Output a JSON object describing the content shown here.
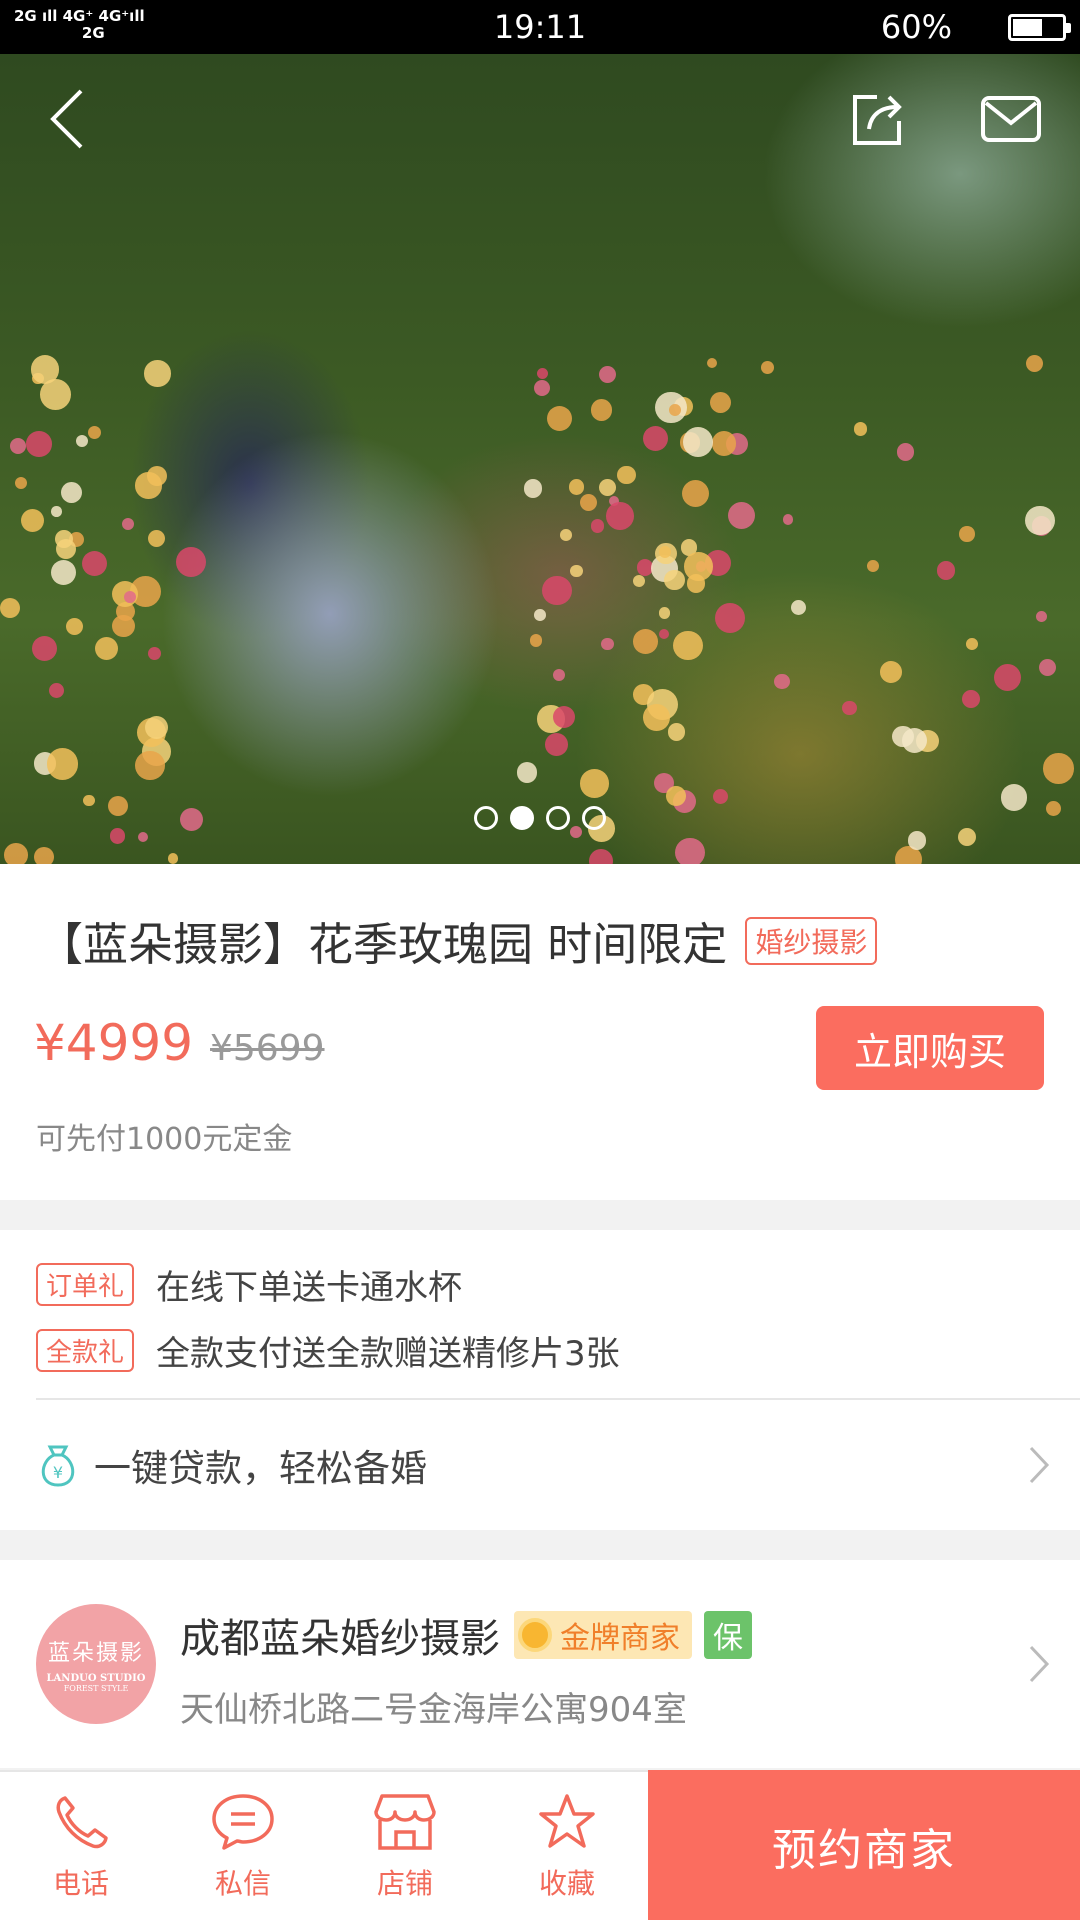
{
  "status_bar": {
    "signal_text": "2G 4G⁺ 4G⁺\n   2G",
    "time": "19:11",
    "battery_percent": "60%",
    "battery_level": 0.6
  },
  "hero": {
    "carousel_total": 4,
    "carousel_active_index": 1
  },
  "product": {
    "title": "【蓝朵摄影】花季玫瑰园 时间限定",
    "category_tag": "婚纱摄影",
    "price": "¥4999",
    "original_price": "¥5699",
    "buy_label": "立即购买",
    "deposit_note": "可先付1000元定金"
  },
  "gifts": [
    {
      "tag": "订单礼",
      "text": "在线下单送卡通水杯"
    },
    {
      "tag": "全款礼",
      "text": "全款支付送全款赠送精修片3张"
    }
  ],
  "loan": {
    "text": "一键贷款，轻松备婚"
  },
  "merchant": {
    "logo_title": "蓝朵摄影",
    "logo_sub1": "LANDUO STUDIO",
    "logo_sub2": "FOREST STYLE",
    "name": "成都蓝朵婚纱摄影",
    "gold_badge": "金牌商家",
    "guarantee_badge": "保",
    "address": "天仙桥北路二号金海岸公寓904室"
  },
  "bottom_bar": {
    "tabs": [
      {
        "label": "电话",
        "icon": "phone-icon"
      },
      {
        "label": "私信",
        "icon": "message-icon"
      },
      {
        "label": "店铺",
        "icon": "store-icon"
      },
      {
        "label": "收藏",
        "icon": "star-icon"
      }
    ],
    "book_label": "预约商家"
  },
  "colors": {
    "accent": "#fb6d5f",
    "accent_text": "#f26b5b",
    "gold_bg": "#fde7b4",
    "gold_text": "#f07f2a",
    "guarantee": "#6cc36a"
  }
}
